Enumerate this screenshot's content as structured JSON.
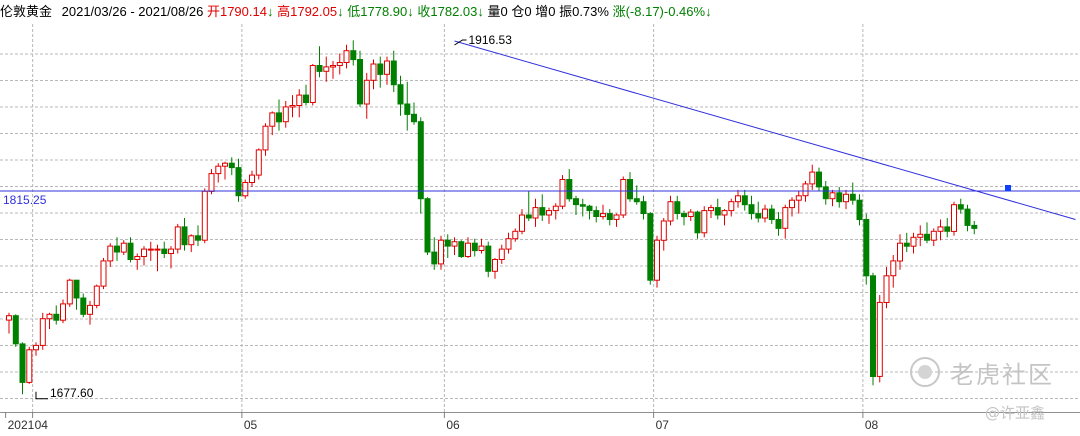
{
  "header": {
    "name": "伦敦黄金",
    "range": "2021/03/26 - 2021/08/26",
    "open_label": "开",
    "open": "1790.14",
    "open_arrow": "↓",
    "high_label": "高",
    "high": "1792.05",
    "high_arrow": "↓",
    "low_label": "低",
    "low": "1778.90",
    "low_arrow": "↓",
    "close_label": "收",
    "close": "1782.03",
    "close_arrow": "↓",
    "volume": "量0",
    "position": "仓0",
    "increase": "增0",
    "amplitude": "振0.73%",
    "change": "涨(-8.17)-0.46%",
    "change_arrow": "↓"
  },
  "watermark": {
    "brand": "老虎社区",
    "author": "@许亚鑫"
  },
  "colors": {
    "up": "#e00000",
    "down": "#008000",
    "trendline": "#3030dd",
    "hline": "#3030dd",
    "grid": "#b8b8b8",
    "marker": "#1040ff"
  },
  "chart_data": {
    "type": "candlestick",
    "ylim": [
      1666,
      1928
    ],
    "x_labels": [
      {
        "label": "2021",
        "index": 0
      },
      {
        "label": "04",
        "index": 4
      },
      {
        "label": "05",
        "index": 35
      },
      {
        "label": "06",
        "index": 65
      },
      {
        "label": "07",
        "index": 96
      },
      {
        "label": "08",
        "index": 127
      }
    ],
    "high_annotation": {
      "label": "1916.53",
      "index": 66,
      "value": 1916.53
    },
    "low_annotation": {
      "label": "1677.60",
      "index": 4,
      "value": 1677.6
    },
    "hline": {
      "label": "1815.25",
      "value": 1815.25
    },
    "trendline": {
      "from": {
        "index": 66,
        "value": 1916.53
      },
      "to": {
        "index": 158,
        "value": 1796
      }
    },
    "marker": {
      "index": 148,
      "value": 1815.25
    },
    "candles": [
      [
        1728,
        1733,
        1719,
        1731
      ],
      [
        1731,
        1732,
        1710,
        1712
      ],
      [
        1712,
        1713,
        1678,
        1686
      ],
      [
        1686,
        1710,
        1685,
        1708
      ],
      [
        1708,
        1713,
        1704,
        1711
      ],
      [
        1711,
        1733,
        1708,
        1729
      ],
      [
        1729,
        1733,
        1722,
        1732
      ],
      [
        1732,
        1738,
        1725,
        1728
      ],
      [
        1728,
        1742,
        1726,
        1739
      ],
      [
        1739,
        1756,
        1737,
        1755
      ],
      [
        1755,
        1755,
        1735,
        1743
      ],
      [
        1743,
        1746,
        1730,
        1732
      ],
      [
        1732,
        1741,
        1725,
        1738
      ],
      [
        1738,
        1752,
        1736,
        1751
      ],
      [
        1751,
        1770,
        1749,
        1768
      ],
      [
        1768,
        1780,
        1764,
        1778
      ],
      [
        1778,
        1784,
        1768,
        1774
      ],
      [
        1774,
        1782,
        1772,
        1780
      ],
      [
        1780,
        1784,
        1767,
        1769
      ],
      [
        1769,
        1773,
        1762,
        1771
      ],
      [
        1771,
        1778,
        1765,
        1776
      ],
      [
        1776,
        1781,
        1768,
        1776
      ],
      [
        1776,
        1779,
        1761,
        1776
      ],
      [
        1776,
        1781,
        1770,
        1773
      ],
      [
        1773,
        1778,
        1763,
        1776
      ],
      [
        1776,
        1793,
        1773,
        1791
      ],
      [
        1791,
        1797,
        1775,
        1779
      ],
      [
        1779,
        1786,
        1774,
        1785
      ],
      [
        1785,
        1792,
        1778,
        1782
      ],
      [
        1782,
        1817,
        1780,
        1815
      ],
      [
        1815,
        1830,
        1813,
        1827
      ],
      [
        1827,
        1834,
        1821,
        1832
      ],
      [
        1832,
        1835,
        1823,
        1834
      ],
      [
        1834,
        1838,
        1826,
        1831
      ],
      [
        1831,
        1837,
        1808,
        1812
      ],
      [
        1812,
        1823,
        1810,
        1821
      ],
      [
        1821,
        1829,
        1818,
        1826
      ],
      [
        1826,
        1844,
        1823,
        1843
      ],
      [
        1843,
        1861,
        1839,
        1859
      ],
      [
        1859,
        1869,
        1853,
        1868
      ],
      [
        1868,
        1877,
        1856,
        1862
      ],
      [
        1862,
        1876,
        1858,
        1872
      ],
      [
        1872,
        1880,
        1865,
        1873
      ],
      [
        1873,
        1884,
        1865,
        1880
      ],
      [
        1880,
        1887,
        1873,
        1875
      ],
      [
        1875,
        1901,
        1873,
        1900
      ],
      [
        1900,
        1913,
        1892,
        1896
      ],
      [
        1896,
        1906,
        1889,
        1899
      ],
      [
        1899,
        1903,
        1891,
        1900
      ],
      [
        1900,
        1908,
        1894,
        1902
      ],
      [
        1902,
        1914,
        1898,
        1910
      ],
      [
        1910,
        1917,
        1900,
        1904
      ],
      [
        1904,
        1910,
        1872,
        1874
      ],
      [
        1874,
        1895,
        1864,
        1890
      ],
      [
        1890,
        1904,
        1884,
        1901
      ],
      [
        1901,
        1906,
        1885,
        1894
      ],
      [
        1894,
        1906,
        1887,
        1903
      ],
      [
        1903,
        1910,
        1882,
        1887
      ],
      [
        1887,
        1893,
        1866,
        1874
      ],
      [
        1874,
        1889,
        1856,
        1867
      ],
      [
        1867,
        1875,
        1860,
        1862
      ],
      [
        1862,
        1865,
        1800,
        1810
      ],
      [
        1810,
        1811,
        1772,
        1774
      ],
      [
        1774,
        1784,
        1762,
        1766
      ],
      [
        1766,
        1785,
        1762,
        1782
      ],
      [
        1782,
        1786,
        1770,
        1778
      ],
      [
        1778,
        1784,
        1772,
        1781
      ],
      [
        1781,
        1782,
        1770,
        1771
      ],
      [
        1771,
        1784,
        1770,
        1780
      ],
      [
        1780,
        1783,
        1771,
        1775
      ],
      [
        1775,
        1783,
        1773,
        1778
      ],
      [
        1778,
        1781,
        1757,
        1761
      ],
      [
        1761,
        1770,
        1756,
        1769
      ],
      [
        1769,
        1779,
        1766,
        1776
      ],
      [
        1776,
        1787,
        1773,
        1783
      ],
      [
        1783,
        1790,
        1781,
        1788
      ],
      [
        1788,
        1803,
        1786,
        1799
      ],
      [
        1799,
        1815,
        1795,
        1797
      ],
      [
        1797,
        1810,
        1791,
        1804
      ],
      [
        1804,
        1813,
        1795,
        1799
      ],
      [
        1799,
        1804,
        1793,
        1802
      ],
      [
        1802,
        1807,
        1796,
        1805
      ],
      [
        1805,
        1826,
        1803,
        1823
      ],
      [
        1823,
        1830,
        1808,
        1810
      ],
      [
        1810,
        1812,
        1799,
        1806
      ],
      [
        1806,
        1810,
        1798,
        1805
      ],
      [
        1805,
        1806,
        1796,
        1802
      ],
      [
        1802,
        1805,
        1794,
        1798
      ],
      [
        1798,
        1806,
        1796,
        1800
      ],
      [
        1800,
        1803,
        1792,
        1796
      ],
      [
        1796,
        1800,
        1791,
        1799
      ],
      [
        1799,
        1825,
        1797,
        1823
      ],
      [
        1823,
        1828,
        1808,
        1810
      ],
      [
        1810,
        1819,
        1806,
        1808
      ],
      [
        1808,
        1812,
        1796,
        1800
      ],
      [
        1800,
        1801,
        1752,
        1755
      ],
      [
        1755,
        1785,
        1750,
        1782
      ],
      [
        1782,
        1797,
        1775,
        1795
      ],
      [
        1795,
        1812,
        1792,
        1808
      ],
      [
        1808,
        1812,
        1796,
        1800
      ],
      [
        1800,
        1802,
        1792,
        1798
      ],
      [
        1798,
        1803,
        1795,
        1801
      ],
      [
        1801,
        1802,
        1783,
        1787
      ],
      [
        1787,
        1805,
        1784,
        1802
      ],
      [
        1802,
        1806,
        1797,
        1804
      ],
      [
        1804,
        1810,
        1796,
        1799
      ],
      [
        1799,
        1803,
        1792,
        1802
      ],
      [
        1802,
        1810,
        1798,
        1808
      ],
      [
        1808,
        1816,
        1804,
        1812
      ],
      [
        1812,
        1816,
        1802,
        1806
      ],
      [
        1806,
        1812,
        1796,
        1800
      ],
      [
        1800,
        1808,
        1794,
        1797
      ],
      [
        1797,
        1806,
        1794,
        1803
      ],
      [
        1803,
        1806,
        1793,
        1796
      ],
      [
        1796,
        1801,
        1785,
        1790
      ],
      [
        1790,
        1806,
        1783,
        1804
      ],
      [
        1804,
        1811,
        1798,
        1809
      ],
      [
        1809,
        1815,
        1800,
        1812
      ],
      [
        1812,
        1822,
        1808,
        1820
      ],
      [
        1820,
        1833,
        1816,
        1828
      ],
      [
        1828,
        1831,
        1815,
        1818
      ],
      [
        1818,
        1822,
        1806,
        1810
      ],
      [
        1810,
        1816,
        1805,
        1814
      ],
      [
        1814,
        1818,
        1804,
        1808
      ],
      [
        1808,
        1816,
        1803,
        1813
      ],
      [
        1813,
        1821,
        1806,
        1809
      ],
      [
        1809,
        1813,
        1792,
        1796
      ],
      [
        1796,
        1800,
        1752,
        1758
      ],
      [
        1758,
        1760,
        1684,
        1690
      ],
      [
        1690,
        1745,
        1686,
        1740
      ],
      [
        1740,
        1764,
        1736,
        1758
      ],
      [
        1758,
        1772,
        1750,
        1768
      ],
      [
        1768,
        1786,
        1762,
        1780
      ],
      [
        1780,
        1787,
        1774,
        1778
      ],
      [
        1778,
        1787,
        1773,
        1784
      ],
      [
        1784,
        1792,
        1778,
        1786
      ],
      [
        1786,
        1794,
        1780,
        1782
      ],
      [
        1782,
        1790,
        1778,
        1788
      ],
      [
        1788,
        1796,
        1782,
        1791
      ],
      [
        1791,
        1797,
        1784,
        1788
      ],
      [
        1788,
        1808,
        1785,
        1806
      ],
      [
        1806,
        1810,
        1800,
        1803
      ],
      [
        1803,
        1806,
        1788,
        1792
      ],
      [
        1792,
        1795,
        1786,
        1790
      ]
    ]
  }
}
